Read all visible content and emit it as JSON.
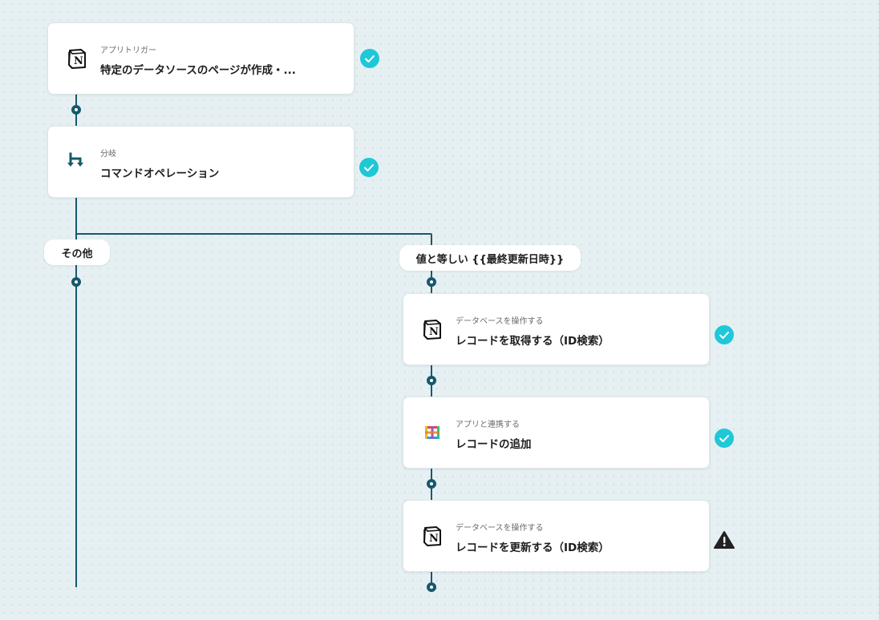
{
  "colors": {
    "connector": "#16596d",
    "check": "#1ec8d8",
    "warning": "#222222"
  },
  "flow": {
    "trigger": {
      "sub": "アプリトリガー",
      "title": "特定のデータソースのページが作成・...",
      "icon": "notion-icon",
      "status": "check"
    },
    "branch": {
      "sub": "分岐",
      "title": "コマンドオペレーション",
      "icon": "branch-icon",
      "status": "check"
    },
    "branch_labels": {
      "other": "その他",
      "equals": "値と等しい {{最終更新日時}}"
    },
    "steps": [
      {
        "sub": "データベースを操作する",
        "title": "レコードを取得する（ID検索）",
        "icon": "notion-icon",
        "status": "check"
      },
      {
        "sub": "アプリと連携する",
        "title": "レコードの追加",
        "icon": "grid-app-icon",
        "status": "check"
      },
      {
        "sub": "データベースを操作する",
        "title": "レコードを更新する（ID検索）",
        "icon": "notion-icon",
        "status": "warning"
      }
    ]
  }
}
